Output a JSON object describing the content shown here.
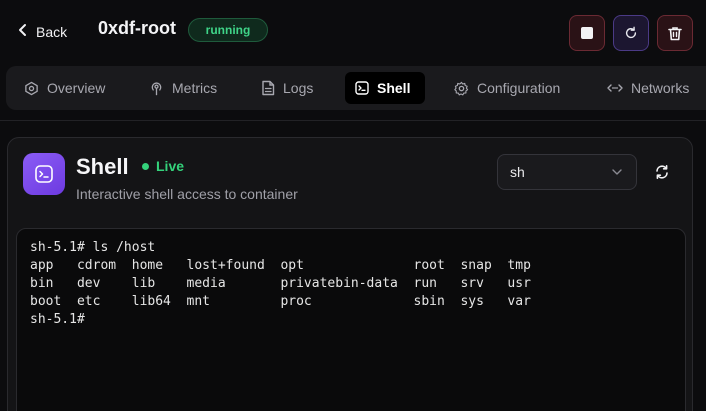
{
  "header": {
    "back_label": "Back",
    "container_name": "0xdf-root",
    "status": "running"
  },
  "tabs": [
    {
      "label": "Overview",
      "icon": "overview-icon",
      "active": false
    },
    {
      "label": "Metrics",
      "icon": "metrics-icon",
      "active": false
    },
    {
      "label": "Logs",
      "icon": "logs-icon",
      "active": false
    },
    {
      "label": "Shell",
      "icon": "terminal-icon",
      "active": true
    },
    {
      "label": "Configuration",
      "icon": "gear-icon",
      "active": false
    },
    {
      "label": "Networks",
      "icon": "network-icon",
      "active": false
    }
  ],
  "shell": {
    "title": "Shell",
    "live_label": "Live",
    "subtitle": "Interactive shell access to container",
    "selected_shell": "sh"
  },
  "terminal": {
    "lines": [
      "sh-5.1# ls /host",
      "app   cdrom  home   lost+found  opt              root  snap  tmp",
      "bin   dev    lib    media       privatebin-data  run   srv   usr",
      "boot  etc    lib64  mnt         proc             sbin  sys   var",
      "sh-5.1#"
    ]
  },
  "colors": {
    "background": "#0c0c0e",
    "status_green": "#3fd488",
    "accent_purple": "#8b5cf6",
    "danger_red": "#6b2a33"
  }
}
